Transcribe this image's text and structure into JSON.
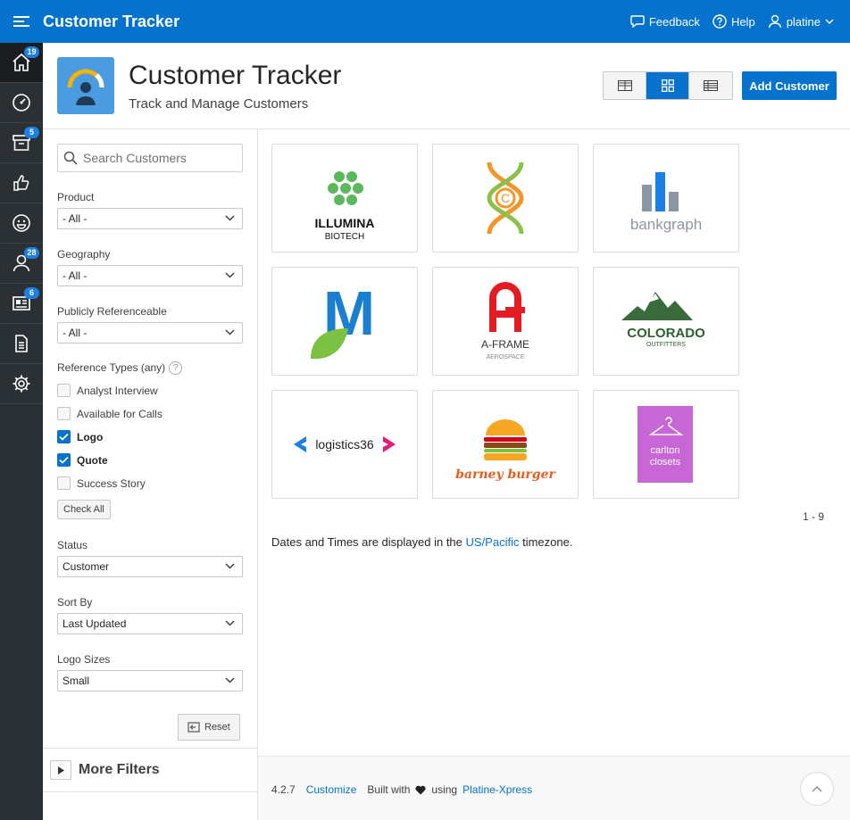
{
  "app": {
    "title": "Customer Tracker"
  },
  "topbar": {
    "feedback": "Feedback",
    "help": "Help",
    "user": "platine"
  },
  "nav": [
    {
      "icon": "home-icon",
      "badge": "19"
    },
    {
      "icon": "dashboard-icon",
      "badge": ""
    },
    {
      "icon": "archive-icon",
      "badge": "5"
    },
    {
      "icon": "thumbs-up-icon",
      "badge": ""
    },
    {
      "icon": "emoji-icon",
      "badge": ""
    },
    {
      "icon": "user-icon",
      "badge": "28"
    },
    {
      "icon": "newspaper-icon",
      "badge": "6"
    },
    {
      "icon": "document-icon",
      "badge": ""
    },
    {
      "icon": "gear-icon",
      "badge": ""
    }
  ],
  "header": {
    "title": "Customer Tracker",
    "subtitle": "Track and Manage Customers",
    "add_label": "Add Customer"
  },
  "filters": {
    "search_placeholder": "Search Customers",
    "product": {
      "label": "Product",
      "value": "- All -"
    },
    "geography": {
      "label": "Geography",
      "value": "- All -"
    },
    "publicly": {
      "label": "Publicly Referenceable",
      "value": "- All -"
    },
    "ref_types": {
      "label": "Reference Types (any)",
      "help": "?",
      "options": [
        {
          "label": "Analyst Interview",
          "checked": false
        },
        {
          "label": "Available for Calls",
          "checked": false
        },
        {
          "label": "Logo",
          "checked": true
        },
        {
          "label": "Quote",
          "checked": true
        },
        {
          "label": "Success Story",
          "checked": false
        }
      ],
      "check_all": "Check All"
    },
    "status": {
      "label": "Status",
      "value": "Customer"
    },
    "sort": {
      "label": "Sort By",
      "value": "Last Updated"
    },
    "logo_size": {
      "label": "Logo Sizes",
      "value": "Small"
    },
    "reset": "Reset",
    "more": "More Filters"
  },
  "customers": [
    {
      "name": "ILLUMINA",
      "sub": "BIOTECH"
    },
    {
      "name": "C",
      "sub": ""
    },
    {
      "name": "bankgraph",
      "sub": ""
    },
    {
      "name": "M",
      "sub": ""
    },
    {
      "name": "A-FRAME",
      "sub": "AEROSPACE"
    },
    {
      "name": "COLORADO",
      "sub": "OUTFITTERS"
    },
    {
      "name": "logistics36",
      "sub": ""
    },
    {
      "name": "barney burger",
      "sub": ""
    },
    {
      "name": "carlton",
      "sub": "closets"
    }
  ],
  "pager": "1 - 9",
  "tz": {
    "before": "Dates and Times are displayed in the ",
    "link": "US/Pacific",
    "after": " timezone."
  },
  "footer": {
    "version": "4.2.7",
    "customize": "Customize",
    "built": "Built with",
    "using": "using",
    "platform": "Platine-Xpress"
  },
  "colors": {
    "accent": "#0572ce",
    "nav": "#2b3034"
  }
}
